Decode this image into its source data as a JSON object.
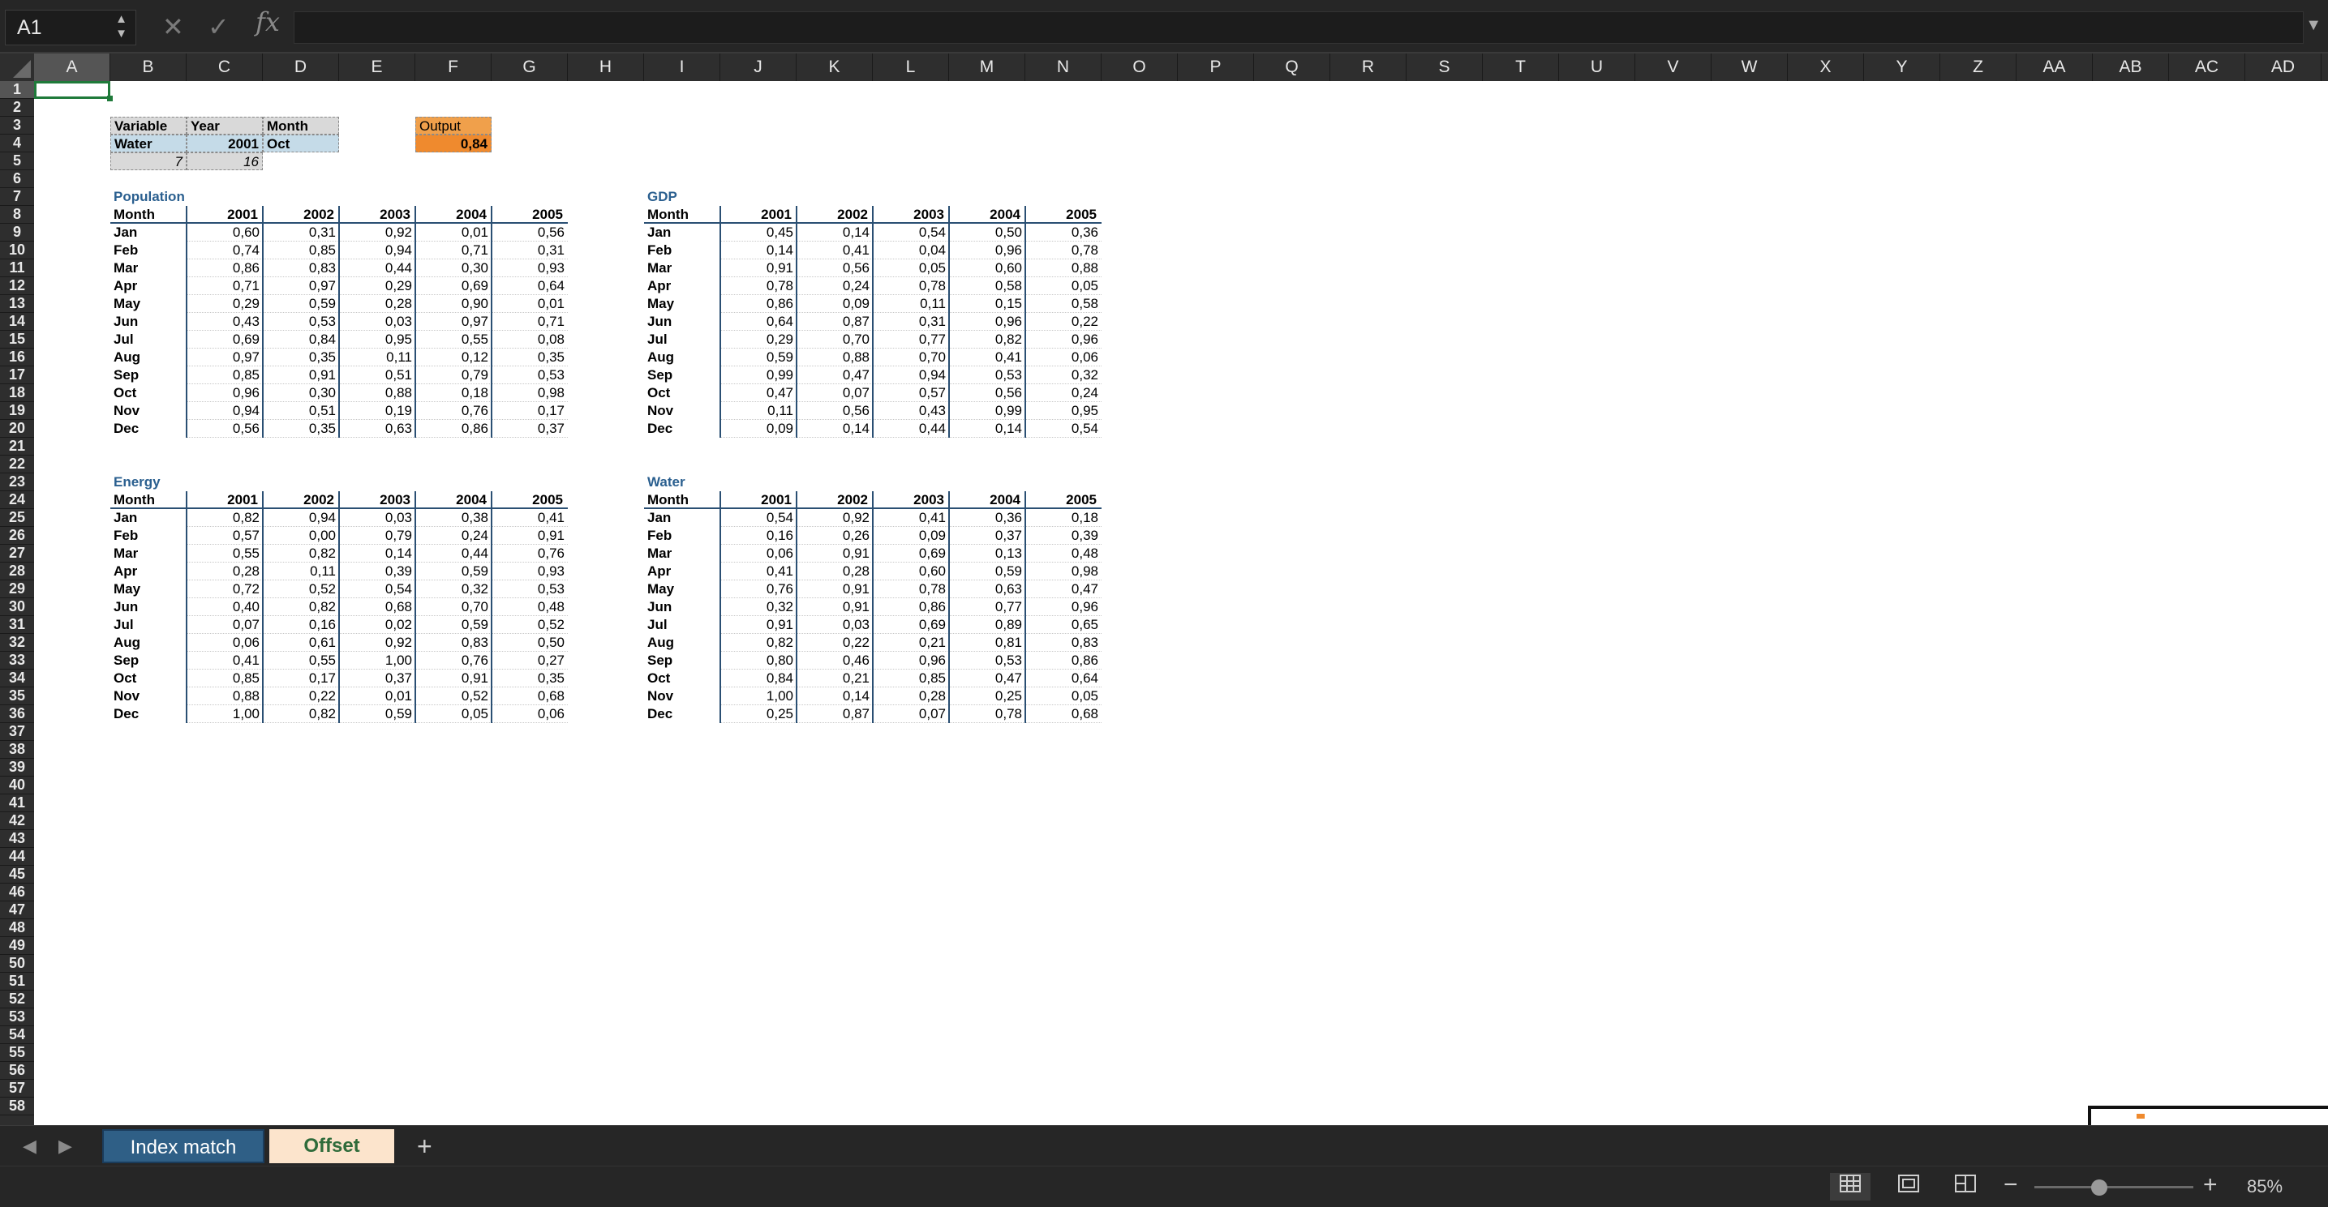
{
  "formula_bar": {
    "name_box": "A1",
    "cancel_icon": "✕",
    "confirm_icon": "✓",
    "fx_label": "fx",
    "formula": ""
  },
  "columns": [
    "A",
    "B",
    "C",
    "D",
    "E",
    "F",
    "G",
    "H",
    "I",
    "J",
    "K",
    "L",
    "M",
    "N",
    "O",
    "P",
    "Q",
    "R",
    "S",
    "T",
    "U",
    "V",
    "W",
    "X",
    "Y",
    "Z",
    "AA",
    "AB",
    "AC",
    "AD"
  ],
  "rows": [
    "1",
    "2",
    "3",
    "4",
    "5",
    "6",
    "7",
    "8",
    "9",
    "10",
    "11",
    "12",
    "13",
    "14",
    "15",
    "16",
    "17",
    "18",
    "19",
    "20",
    "21",
    "22",
    "23",
    "24",
    "25",
    "26",
    "27",
    "28",
    "29",
    "30",
    "31",
    "32",
    "33",
    "34",
    "35",
    "36",
    "37",
    "38",
    "39",
    "40",
    "41",
    "42",
    "43",
    "44",
    "45",
    "46",
    "47",
    "48",
    "49",
    "50",
    "51",
    "52",
    "53",
    "54",
    "55",
    "56",
    "57",
    "58"
  ],
  "selected_cell": "A1",
  "inputs": {
    "variable_label": "Variable",
    "year_label": "Year",
    "month_label": "Month",
    "variable_value": "Water",
    "year_value": "2001",
    "month_value": "Oct",
    "row_index": "7",
    "col_index": "16",
    "output_label": "Output",
    "output_value": "0,84"
  },
  "tables": [
    {
      "title": "Population",
      "month_header": "Month",
      "years": [
        "2001",
        "2002",
        "2003",
        "2004",
        "2005"
      ],
      "rows": [
        {
          "month": "Jan",
          "values": [
            "0,60",
            "0,31",
            "0,92",
            "0,01",
            "0,56"
          ]
        },
        {
          "month": "Feb",
          "values": [
            "0,74",
            "0,85",
            "0,94",
            "0,71",
            "0,31"
          ]
        },
        {
          "month": "Mar",
          "values": [
            "0,86",
            "0,83",
            "0,44",
            "0,30",
            "0,93"
          ]
        },
        {
          "month": "Apr",
          "values": [
            "0,71",
            "0,97",
            "0,29",
            "0,69",
            "0,64"
          ]
        },
        {
          "month": "May",
          "values": [
            "0,29",
            "0,59",
            "0,28",
            "0,90",
            "0,01"
          ]
        },
        {
          "month": "Jun",
          "values": [
            "0,43",
            "0,53",
            "0,03",
            "0,97",
            "0,71"
          ]
        },
        {
          "month": "Jul",
          "values": [
            "0,69",
            "0,84",
            "0,95",
            "0,55",
            "0,08"
          ]
        },
        {
          "month": "Aug",
          "values": [
            "0,97",
            "0,35",
            "0,11",
            "0,12",
            "0,35"
          ]
        },
        {
          "month": "Sep",
          "values": [
            "0,85",
            "0,91",
            "0,51",
            "0,79",
            "0,53"
          ]
        },
        {
          "month": "Oct",
          "values": [
            "0,96",
            "0,30",
            "0,88",
            "0,18",
            "0,98"
          ]
        },
        {
          "month": "Nov",
          "values": [
            "0,94",
            "0,51",
            "0,19",
            "0,76",
            "0,17"
          ]
        },
        {
          "month": "Dec",
          "values": [
            "0,56",
            "0,35",
            "0,63",
            "0,86",
            "0,37"
          ]
        }
      ]
    },
    {
      "title": "GDP",
      "month_header": "Month",
      "years": [
        "2001",
        "2002",
        "2003",
        "2004",
        "2005"
      ],
      "rows": [
        {
          "month": "Jan",
          "values": [
            "0,45",
            "0,14",
            "0,54",
            "0,50",
            "0,36"
          ]
        },
        {
          "month": "Feb",
          "values": [
            "0,14",
            "0,41",
            "0,04",
            "0,96",
            "0,78"
          ]
        },
        {
          "month": "Mar",
          "values": [
            "0,91",
            "0,56",
            "0,05",
            "0,60",
            "0,88"
          ]
        },
        {
          "month": "Apr",
          "values": [
            "0,78",
            "0,24",
            "0,78",
            "0,58",
            "0,05"
          ]
        },
        {
          "month": "May",
          "values": [
            "0,86",
            "0,09",
            "0,11",
            "0,15",
            "0,58"
          ]
        },
        {
          "month": "Jun",
          "values": [
            "0,64",
            "0,87",
            "0,31",
            "0,96",
            "0,22"
          ]
        },
        {
          "month": "Jul",
          "values": [
            "0,29",
            "0,70",
            "0,77",
            "0,82",
            "0,96"
          ]
        },
        {
          "month": "Aug",
          "values": [
            "0,59",
            "0,88",
            "0,70",
            "0,41",
            "0,06"
          ]
        },
        {
          "month": "Sep",
          "values": [
            "0,99",
            "0,47",
            "0,94",
            "0,53",
            "0,32"
          ]
        },
        {
          "month": "Oct",
          "values": [
            "0,47",
            "0,07",
            "0,57",
            "0,56",
            "0,24"
          ]
        },
        {
          "month": "Nov",
          "values": [
            "0,11",
            "0,56",
            "0,43",
            "0,99",
            "0,95"
          ]
        },
        {
          "month": "Dec",
          "values": [
            "0,09",
            "0,14",
            "0,44",
            "0,14",
            "0,54"
          ]
        }
      ]
    },
    {
      "title": "Energy",
      "month_header": "Month",
      "years": [
        "2001",
        "2002",
        "2003",
        "2004",
        "2005"
      ],
      "rows": [
        {
          "month": "Jan",
          "values": [
            "0,82",
            "0,94",
            "0,03",
            "0,38",
            "0,41"
          ]
        },
        {
          "month": "Feb",
          "values": [
            "0,57",
            "0,00",
            "0,79",
            "0,24",
            "0,91"
          ]
        },
        {
          "month": "Mar",
          "values": [
            "0,55",
            "0,82",
            "0,14",
            "0,44",
            "0,76"
          ]
        },
        {
          "month": "Apr",
          "values": [
            "0,28",
            "0,11",
            "0,39",
            "0,59",
            "0,93"
          ]
        },
        {
          "month": "May",
          "values": [
            "0,72",
            "0,52",
            "0,54",
            "0,32",
            "0,53"
          ]
        },
        {
          "month": "Jun",
          "values": [
            "0,40",
            "0,82",
            "0,68",
            "0,70",
            "0,48"
          ]
        },
        {
          "month": "Jul",
          "values": [
            "0,07",
            "0,16",
            "0,02",
            "0,59",
            "0,52"
          ]
        },
        {
          "month": "Aug",
          "values": [
            "0,06",
            "0,61",
            "0,92",
            "0,83",
            "0,50"
          ]
        },
        {
          "month": "Sep",
          "values": [
            "0,41",
            "0,55",
            "1,00",
            "0,76",
            "0,27"
          ]
        },
        {
          "month": "Oct",
          "values": [
            "0,85",
            "0,17",
            "0,37",
            "0,91",
            "0,35"
          ]
        },
        {
          "month": "Nov",
          "values": [
            "0,88",
            "0,22",
            "0,01",
            "0,52",
            "0,68"
          ]
        },
        {
          "month": "Dec",
          "values": [
            "1,00",
            "0,82",
            "0,59",
            "0,05",
            "0,06"
          ]
        }
      ]
    },
    {
      "title": "Water",
      "month_header": "Month",
      "years": [
        "2001",
        "2002",
        "2003",
        "2004",
        "2005"
      ],
      "rows": [
        {
          "month": "Jan",
          "values": [
            "0,54",
            "0,92",
            "0,41",
            "0,36",
            "0,18"
          ]
        },
        {
          "month": "Feb",
          "values": [
            "0,16",
            "0,26",
            "0,09",
            "0,37",
            "0,39"
          ]
        },
        {
          "month": "Mar",
          "values": [
            "0,06",
            "0,91",
            "0,69",
            "0,13",
            "0,48"
          ]
        },
        {
          "month": "Apr",
          "values": [
            "0,41",
            "0,28",
            "0,60",
            "0,59",
            "0,98"
          ]
        },
        {
          "month": "May",
          "values": [
            "0,76",
            "0,91",
            "0,78",
            "0,63",
            "0,47"
          ]
        },
        {
          "month": "Jun",
          "values": [
            "0,32",
            "0,91",
            "0,86",
            "0,77",
            "0,96"
          ]
        },
        {
          "month": "Jul",
          "values": [
            "0,91",
            "0,03",
            "0,69",
            "0,89",
            "0,65"
          ]
        },
        {
          "month": "Aug",
          "values": [
            "0,82",
            "0,22",
            "0,21",
            "0,81",
            "0,83"
          ]
        },
        {
          "month": "Sep",
          "values": [
            "0,80",
            "0,46",
            "0,96",
            "0,53",
            "0,86"
          ]
        },
        {
          "month": "Oct",
          "values": [
            "0,84",
            "0,21",
            "0,85",
            "0,47",
            "0,64"
          ]
        },
        {
          "month": "Nov",
          "values": [
            "1,00",
            "0,14",
            "0,28",
            "0,25",
            "0,05"
          ]
        },
        {
          "month": "Dec",
          "values": [
            "0,25",
            "0,87",
            "0,07",
            "0,78",
            "0,68"
          ]
        }
      ]
    }
  ],
  "sheet_tabs": {
    "prev_icon": "◀",
    "next_icon": "▶",
    "tabs": [
      "Index match",
      "Offset"
    ],
    "active_tab": "Index match",
    "add_icon": "+"
  },
  "status_bar": {
    "view_normal_icon": "grid-icon",
    "view_page_layout_icon": "page-layout-icon",
    "view_page_break_icon": "page-break-icon",
    "zoom_minus": "−",
    "zoom_plus": "+",
    "zoom_level": "85%"
  },
  "colors": {
    "accent_selection": "#1f7a3a",
    "table_title": "#2a5f8f",
    "input_gray": "#d9d9d9",
    "input_blue": "#c5dbe8",
    "output_orange": "#ef8a2e",
    "active_tab": "#2f5f86",
    "offset_tab": "#fce4cc"
  }
}
